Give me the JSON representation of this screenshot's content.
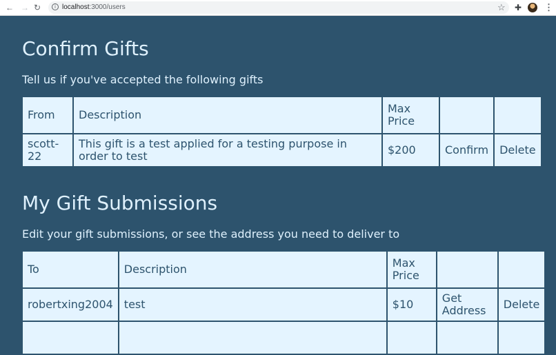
{
  "browser": {
    "url_host": "localhost",
    "url_path": ":3000/users",
    "icons": {
      "back": "back-arrow-icon",
      "forward": "forward-arrow-icon",
      "reload": "reload-icon",
      "info": "info-icon",
      "star": "star-icon",
      "extensions": "puzzle-extensions-icon",
      "profile": "profile-avatar-icon",
      "menu": "kebab-menu-icon"
    }
  },
  "theme": {
    "background": "#2d536d",
    "table_bg": "#e4f4ff",
    "heading": "#dff1fd"
  },
  "confirm": {
    "title": "Confirm Gifts",
    "subtitle": "Tell us if you've accepted the following gifts",
    "headers": {
      "from": "From",
      "description": "Description",
      "max_price": "Max Price"
    },
    "rows": [
      {
        "from": "scott-22",
        "description": "This gift is a test applied for a testing purpose in order to test",
        "price": "$200",
        "confirm": "Confirm",
        "delete": "Delete"
      }
    ]
  },
  "submissions": {
    "title": "My Gift Submissions",
    "subtitle": "Edit your gift submissions, or see the address you need to deliver to",
    "headers": {
      "to": "To",
      "description": "Description",
      "max_price": "Max Price"
    },
    "rows": [
      {
        "to": "robertxing2004",
        "description": "test",
        "price": "$10",
        "get_address": "Get Address",
        "delete": "Delete"
      }
    ]
  }
}
